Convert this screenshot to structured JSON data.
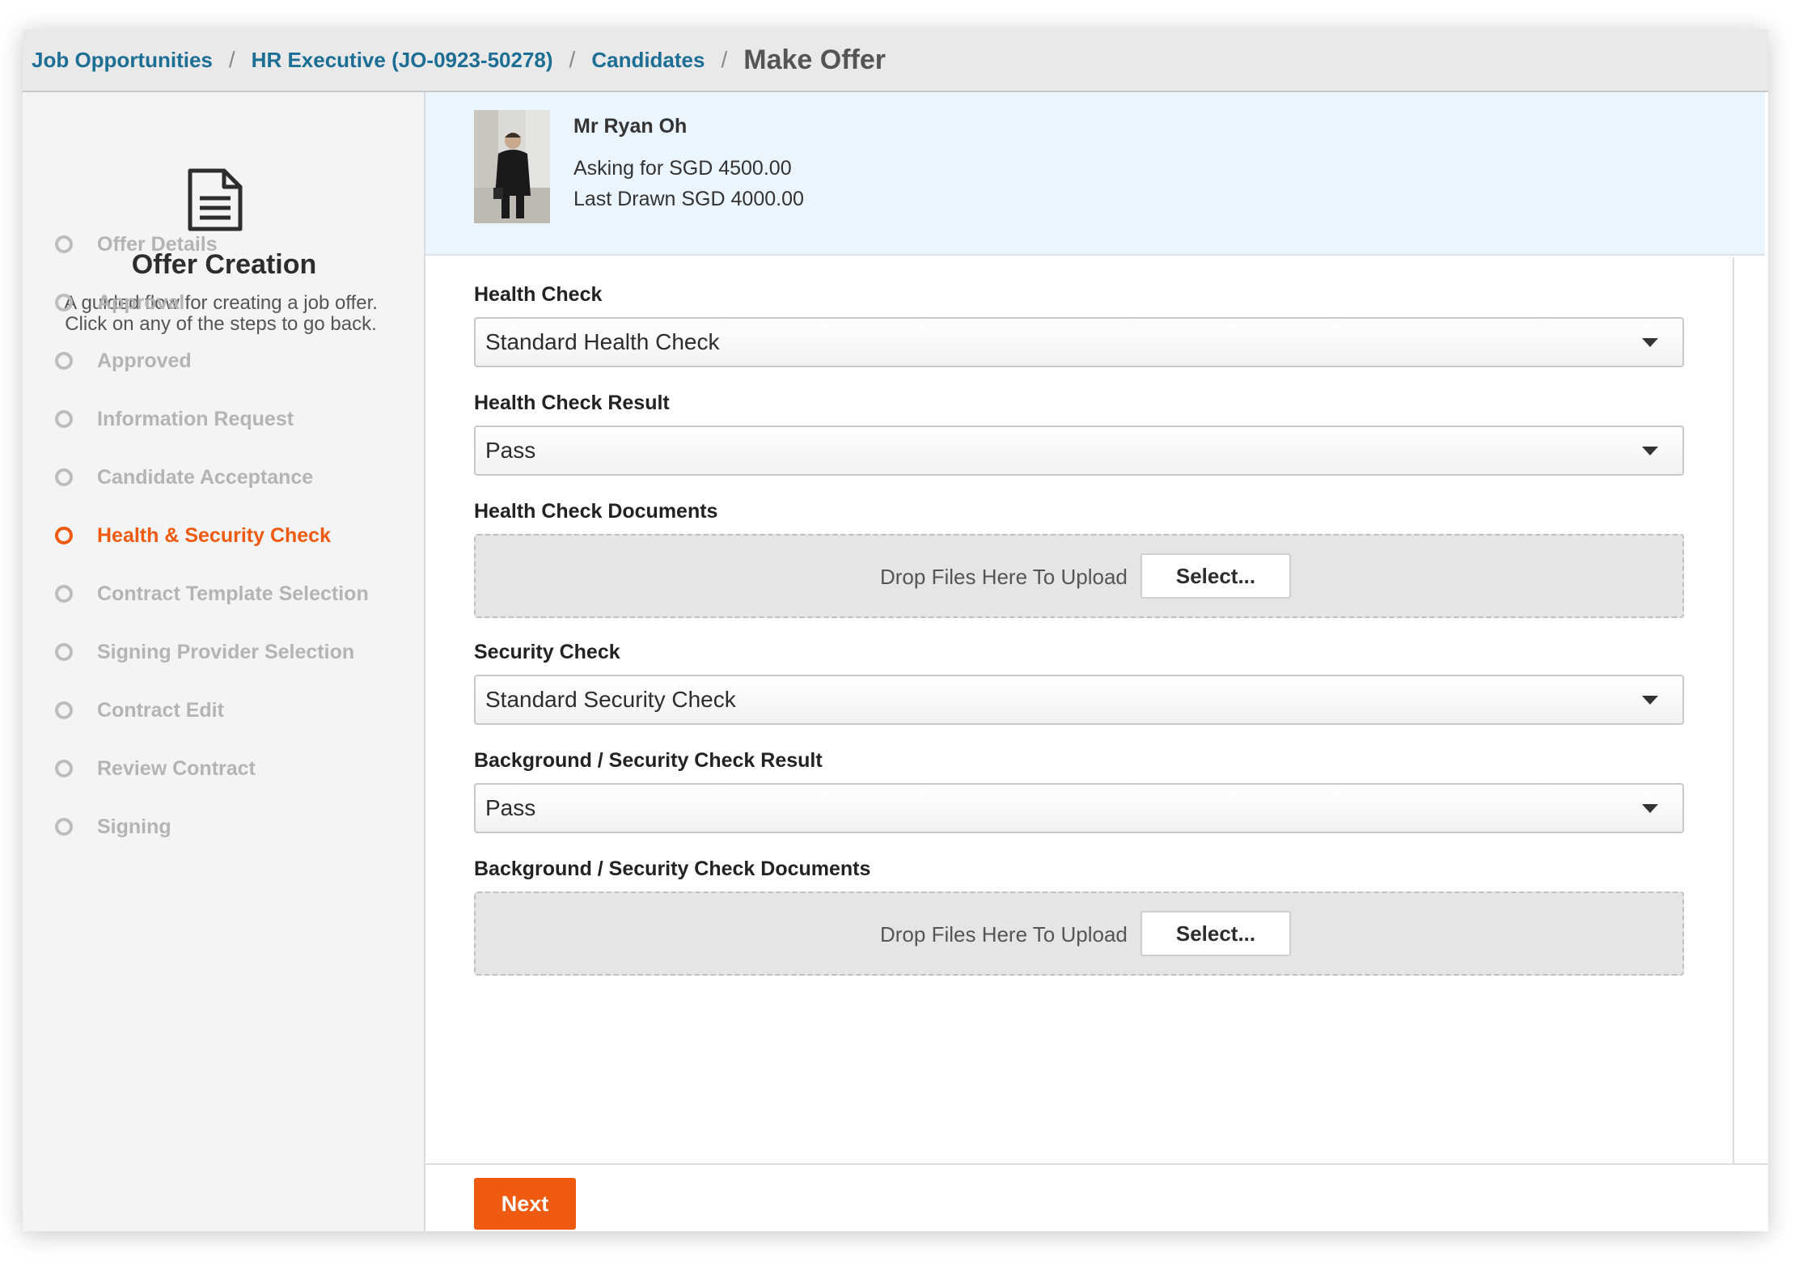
{
  "breadcrumb": {
    "items": [
      "Job Opportunities",
      "HR Executive (JO-0923-50278)",
      "Candidates"
    ],
    "separator": "/",
    "current": "Make Offer"
  },
  "sidebar": {
    "icon": "document-icon",
    "title": "Offer Creation",
    "description": "A guided flow for creating a job offer. Click on any of the steps to go back.",
    "steps": [
      {
        "label": "Offer Details",
        "active": false
      },
      {
        "label": "Approval",
        "active": false
      },
      {
        "label": "Approved",
        "active": false
      },
      {
        "label": "Information Request",
        "active": false
      },
      {
        "label": "Candidate Acceptance",
        "active": false
      },
      {
        "label": "Health & Security Check",
        "active": true
      },
      {
        "label": "Contract Template Selection",
        "active": false
      },
      {
        "label": "Signing Provider Selection",
        "active": false
      },
      {
        "label": "Contract Edit",
        "active": false
      },
      {
        "label": "Review Contract",
        "active": false
      },
      {
        "label": "Signing",
        "active": false
      }
    ]
  },
  "candidate": {
    "name": "Mr Ryan Oh",
    "asking": "Asking for SGD 4500.00",
    "last_drawn": "Last Drawn SGD 4000.00"
  },
  "form": {
    "health_check": {
      "label": "Health Check",
      "value": "Standard Health Check"
    },
    "health_check_result": {
      "label": "Health Check Result",
      "value": "Pass"
    },
    "health_check_documents": {
      "label": "Health Check Documents",
      "drop_text": "Drop Files Here To Upload",
      "select_label": "Select..."
    },
    "security_check": {
      "label": "Security Check",
      "value": "Standard Security Check"
    },
    "security_check_result": {
      "label": "Background / Security Check Result",
      "value": "Pass"
    },
    "security_check_documents": {
      "label": "Background / Security Check Documents",
      "drop_text": "Drop Files Here To Upload",
      "select_label": "Select..."
    }
  },
  "footer": {
    "next_label": "Next"
  },
  "colors": {
    "accent": "#ee5a10",
    "link": "#1c6e94",
    "candidate_bg": "#eaf5fd",
    "sidebar_bg": "#f2f4f5"
  }
}
